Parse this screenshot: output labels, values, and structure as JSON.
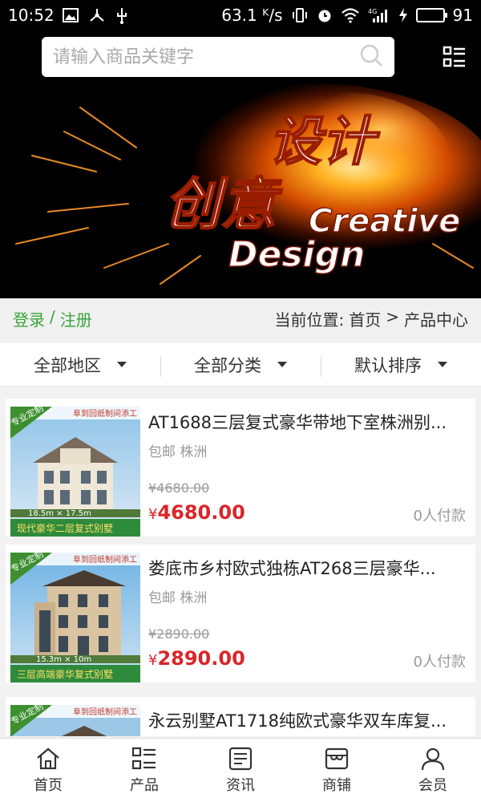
{
  "status": {
    "time": "10:52",
    "speed": "63.1 ᴷ/s",
    "battery": "91",
    "battery_level": 0.91
  },
  "search": {
    "placeholder": "请输入商品关键字"
  },
  "banner": {
    "zh_line1": "设计",
    "zh_line2": "创意",
    "en_line1": "Creative",
    "en_line2": "Design"
  },
  "user": {
    "login": "登录",
    "separator": "/",
    "register": "注册"
  },
  "breadcrumb": {
    "prefix": "当前位置:",
    "home": "首页",
    "arrow": ">",
    "current": "产品中心"
  },
  "filters": [
    {
      "label": "全部地区"
    },
    {
      "label": "全部分类"
    },
    {
      "label": "默认排序"
    }
  ],
  "products": [
    {
      "title": "AT1688三层复式豪华带地下室株洲别...",
      "tag": "包邮 株洲",
      "old_price": "¥4680.00",
      "currency": "¥",
      "price": "4680.00",
      "sold": "0人付款",
      "img_badge": "专业定制",
      "img_top": "阜到回纸制间添工",
      "img_size": "18.5m × 17.5m",
      "img_caption": "现代豪华二层复式别墅"
    },
    {
      "title": "娄底市乡村欧式独栋AT268三层豪华...",
      "tag": "包邮 株洲",
      "old_price": "¥2890.00",
      "currency": "¥",
      "price": "2890.00",
      "sold": "0人付款",
      "img_badge": "专业定制",
      "img_top": "阜到回纸制间添工",
      "img_size": "15.3m × 10m",
      "img_caption": "三层高端豪华复式别墅"
    },
    {
      "title": "永云别墅AT1718纯欧式豪华双车库复...",
      "tag": "",
      "old_price": "",
      "currency": "",
      "price": "",
      "sold": "",
      "img_badge": "专业定制",
      "img_top": "阜到回纸制间添工",
      "img_size": "",
      "img_caption": ""
    }
  ],
  "nav": [
    {
      "label": "首页",
      "icon": "home-icon"
    },
    {
      "label": "产品",
      "icon": "product-list-icon"
    },
    {
      "label": "资讯",
      "icon": "news-icon"
    },
    {
      "label": "商铺",
      "icon": "shop-icon"
    },
    {
      "label": "会员",
      "icon": "member-icon"
    }
  ]
}
